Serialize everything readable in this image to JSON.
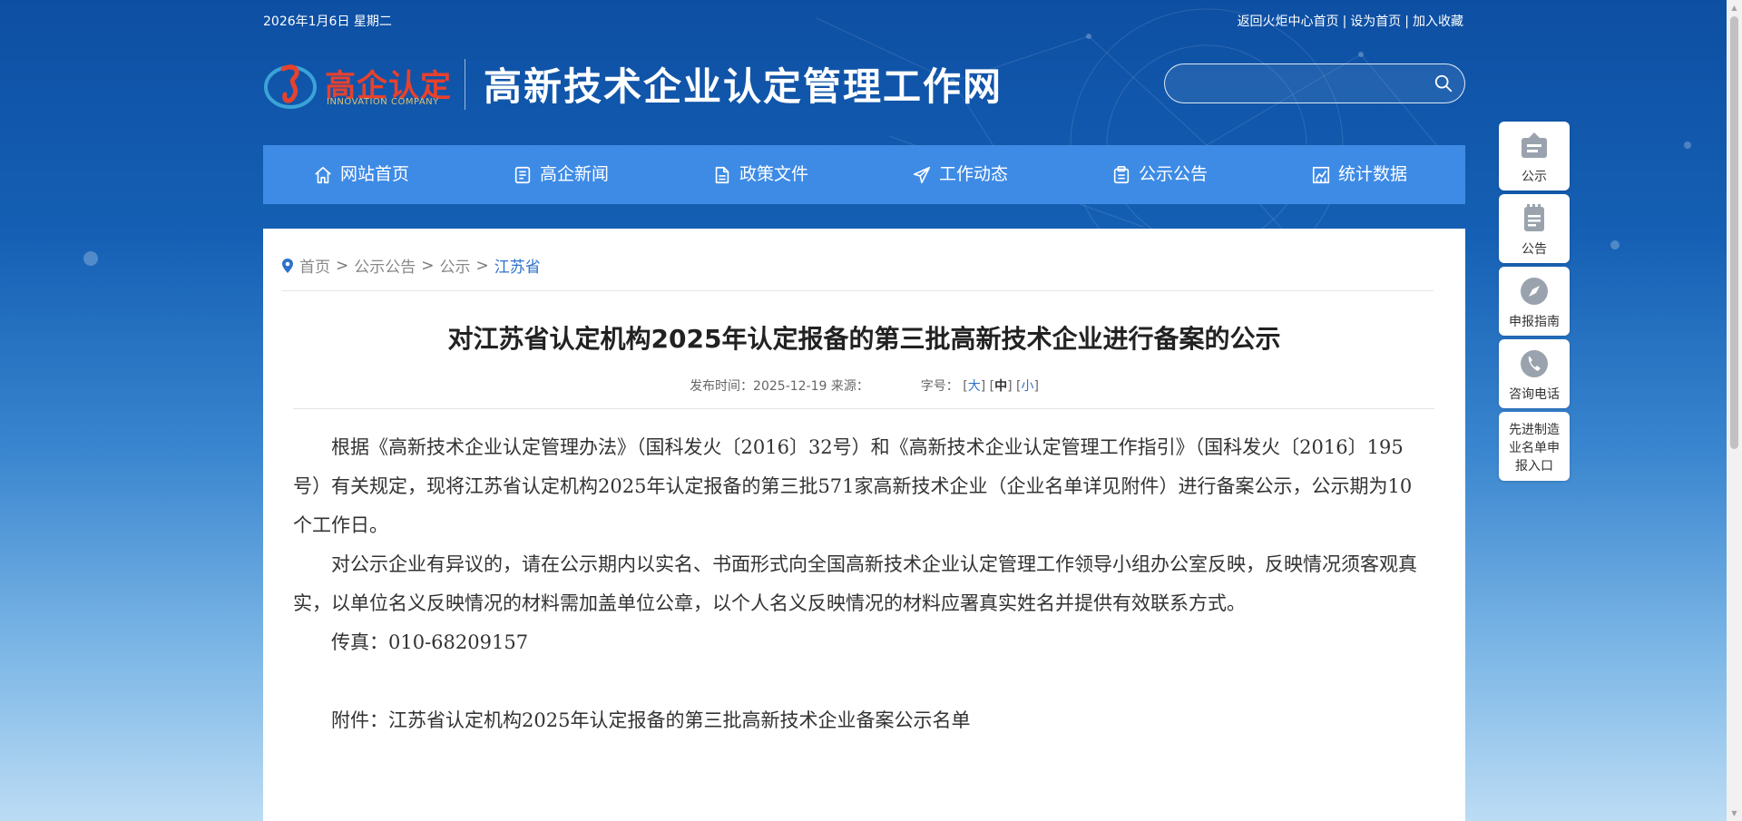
{
  "topbar": {
    "date": "2026年1月6日 星期二",
    "links": [
      "返回火炬中心首页",
      "设为首页",
      "加入收藏"
    ]
  },
  "logo": {
    "cn": "高企认定",
    "en": "INNOVATION COMPANY"
  },
  "site_title": "高新技术企业认定管理工作网",
  "search": {
    "placeholder": ""
  },
  "nav": [
    {
      "label": "网站首页",
      "icon": "home-icon"
    },
    {
      "label": "高企新闻",
      "icon": "news-icon"
    },
    {
      "label": "政策文件",
      "icon": "document-icon"
    },
    {
      "label": "工作动态",
      "icon": "paper-plane-icon"
    },
    {
      "label": "公示公告",
      "icon": "clipboard-icon"
    },
    {
      "label": "统计数据",
      "icon": "chart-icon"
    }
  ],
  "breadcrumb": {
    "items": [
      "首页",
      "公示公告",
      "公示"
    ],
    "current": "江苏省",
    "separator": ">"
  },
  "article": {
    "title": "对江苏省认定机构2025年认定报备的第三批高新技术企业进行备案的公示",
    "meta_time": "发布时间：2025-12-19 来源：",
    "font_size_label": "字号：",
    "font_sizes": [
      "大",
      "中",
      "小"
    ],
    "paragraphs": [
      "根据《高新技术企业认定管理办法》（国科发火〔2016〕32号）和《高新技术企业认定管理工作指引》（国科发火〔2016〕195号）有关规定，现将江苏省认定机构2025年认定报备的第三批571家高新技术企业（企业名单详见附件）进行备案公示，公示期为10个工作日。",
      "对公示企业有异议的，请在公示期内以实名、书面形式向全国高新技术企业认定管理工作领导小组办公室反映，反映情况须客观真实，以单位名义反映情况的材料需加盖单位公章，以个人名义反映情况的材料应署真实姓名并提供有效联系方式。",
      "传真：010-68209157"
    ],
    "attachment": "附件：江苏省认定机构2025年认定报备的第三批高新技术企业备案公示名单"
  },
  "sidebar": [
    {
      "label": "公示",
      "icon": "announcement-board-icon"
    },
    {
      "label": "公告",
      "icon": "notepad-icon"
    },
    {
      "label": "申报指南",
      "icon": "compass-icon"
    },
    {
      "label": "咨询电话",
      "icon": "phone-icon"
    },
    {
      "label": "先进制造业名单申报入口",
      "icon": ""
    }
  ],
  "colors": {
    "nav_bg": "#3e8be6",
    "accent": "#2f72c9",
    "logo_red": "#e8412c"
  }
}
